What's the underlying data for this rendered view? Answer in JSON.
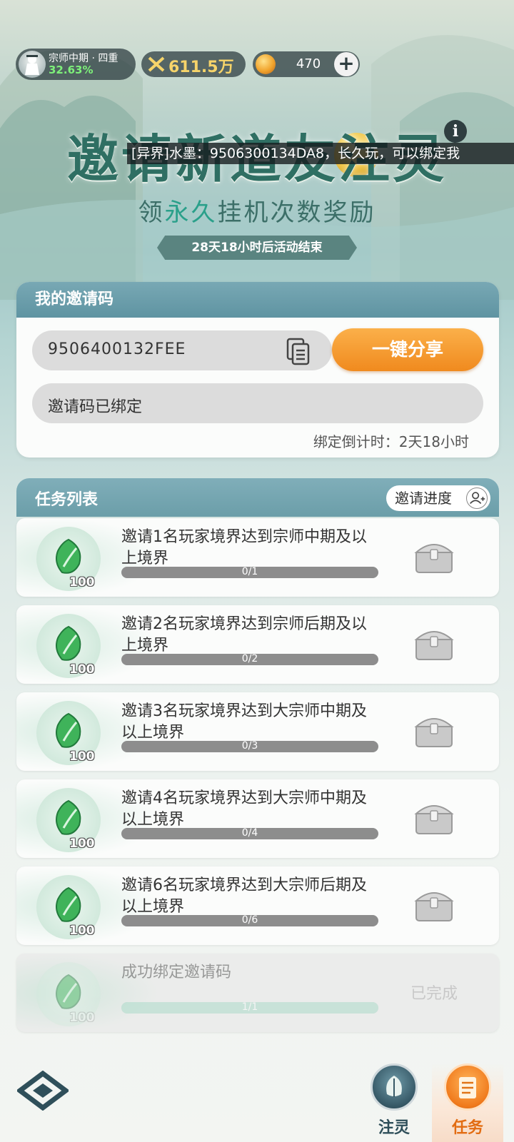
{
  "top_bar": {
    "rank_title": "宗师中期 · 四重",
    "rank_percent": "32.63%",
    "power_value": "611.5万",
    "currency_value": "470",
    "plus_label": "+"
  },
  "header": {
    "title": "邀请新道友注灵",
    "info_label": "i",
    "marquee_text": "[异界]水墨：9506300134DA8，长久玩，可以绑定我",
    "subtitle_pre": "领",
    "subtitle_hl": "永久",
    "subtitle_post": "挂机次数奖励",
    "event_countdown": "28天18小时后活动结束"
  },
  "invite": {
    "heading": "我的邀请码",
    "code": "9506400132FEE",
    "share_button": "一键分享",
    "bound_status": "邀请码已绑定",
    "bind_countdown": "绑定倒计时：2天18小时"
  },
  "tasks": {
    "heading": "任务列表",
    "progress_button": "邀请进度",
    "items": [
      {
        "desc": "邀请1名玩家境界达到宗师中期及以上境界",
        "progress": "0/1",
        "done": 0,
        "total": 1,
        "reward": "100"
      },
      {
        "desc": "邀请2名玩家境界达到宗师后期及以上境界",
        "progress": "0/2",
        "done": 0,
        "total": 2,
        "reward": "100"
      },
      {
        "desc": "邀请3名玩家境界达到大宗师中期及以上境界",
        "progress": "0/3",
        "done": 0,
        "total": 3,
        "reward": "100"
      },
      {
        "desc": "邀请4名玩家境界达到大宗师中期及以上境界",
        "progress": "0/4",
        "done": 0,
        "total": 4,
        "reward": "100"
      },
      {
        "desc": "邀请6名玩家境界达到大宗师后期及以上境界",
        "progress": "0/6",
        "done": 0,
        "total": 6,
        "reward": "100"
      },
      {
        "desc": "成功绑定邀请码",
        "progress": "1/1",
        "done": 1,
        "total": 1,
        "reward": "100",
        "status": "已完成"
      }
    ]
  },
  "nav": {
    "zhuling_label": "注灵",
    "renwu_label": "任务"
  },
  "colors": {
    "accent_orange": "#f08a1e",
    "title_green": "#2f6f63",
    "header_teal": "#6b9ea9",
    "rank_percent_green": "#7ef07a",
    "power_gold": "#f6d46a"
  }
}
